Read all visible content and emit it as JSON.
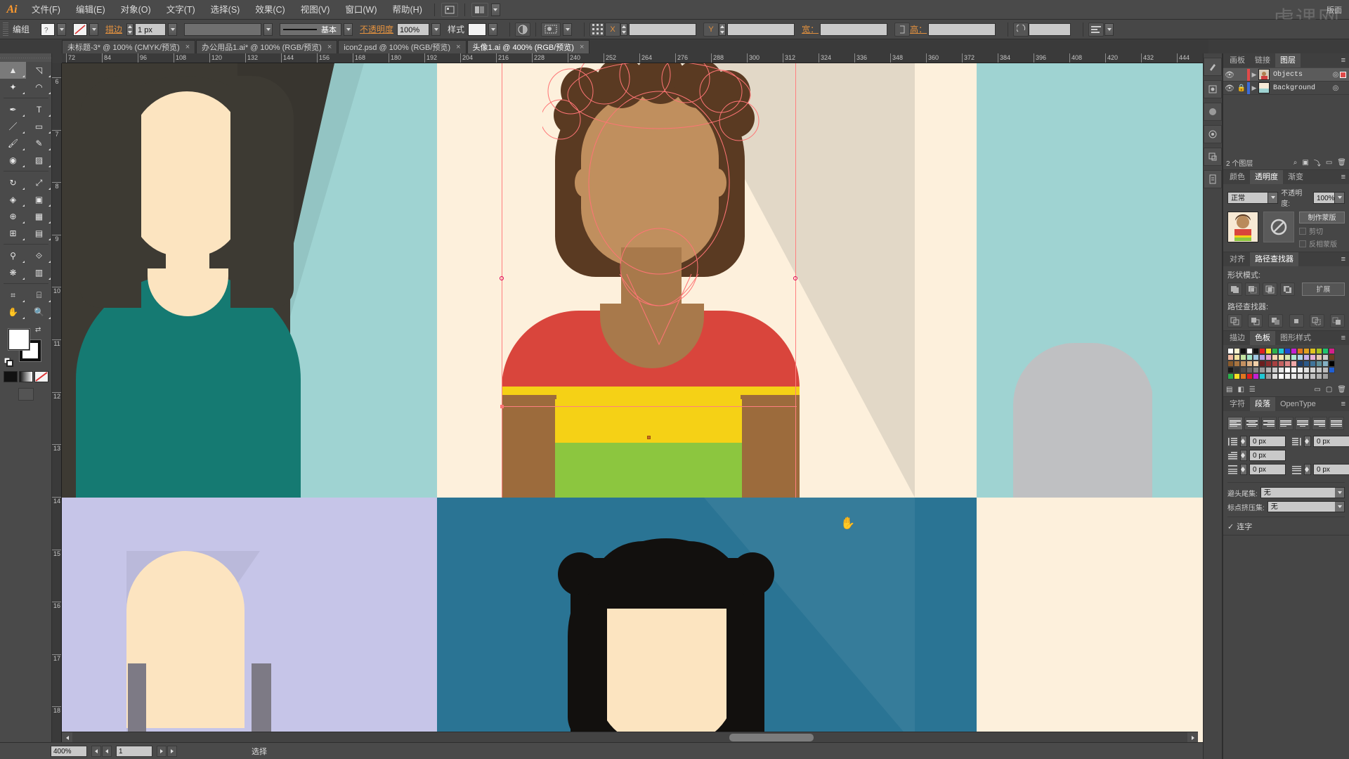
{
  "app": {
    "name": "Ai",
    "workspace_label": "版面"
  },
  "menubar": {
    "items": [
      {
        "label": "文件(F)",
        "name": "menu-file"
      },
      {
        "label": "编辑(E)",
        "name": "menu-edit"
      },
      {
        "label": "对象(O)",
        "name": "menu-object"
      },
      {
        "label": "文字(T)",
        "name": "menu-type"
      },
      {
        "label": "选择(S)",
        "name": "menu-select"
      },
      {
        "label": "效果(C)",
        "name": "menu-effect"
      },
      {
        "label": "视图(V)",
        "name": "menu-view"
      },
      {
        "label": "窗口(W)",
        "name": "menu-window"
      },
      {
        "label": "帮助(H)",
        "name": "menu-help"
      }
    ]
  },
  "controlbar": {
    "selection_label": "编组",
    "fill_swatch": "#f3f3f3",
    "stroke_label": "描边",
    "stroke_weight": "1 px",
    "stroke_profile_placeholder": "",
    "brush_label": "基本",
    "opacity_label": "不透明度",
    "opacity_value": "100%",
    "style_label": "样式",
    "transform_x": "",
    "transform_y": "",
    "width_label": "宽：",
    "width_value": "",
    "height_label": "高：",
    "height_value": "",
    "angle_value": ""
  },
  "tabs": [
    {
      "title": "未标题-3* @ 100% (CMYK/预览)",
      "active": false
    },
    {
      "title": "办公用品1.ai* @ 100% (RGB/预览)",
      "active": false
    },
    {
      "title": "icon2.psd @ 100% (RGB/预览)",
      "active": false
    },
    {
      "title": "头像1.ai @ 400% (RGB/预览)",
      "active": true
    }
  ],
  "rulers": {
    "h_ticks": [
      "72",
      "84",
      "96",
      "108",
      "120",
      "132",
      "144",
      "156",
      "168",
      "180",
      "192",
      "204",
      "216",
      "228",
      "240",
      "252",
      "264",
      "276",
      "288",
      "300",
      "312",
      "324",
      "336",
      "348",
      "360",
      "372",
      "384",
      "396",
      "408",
      "420",
      "432",
      "444"
    ],
    "v_ticks": [
      "6",
      "7",
      "8",
      "9",
      "10",
      "11",
      "12",
      "13",
      "14",
      "15",
      "16",
      "17",
      "18"
    ]
  },
  "toolbox": {
    "tools": [
      {
        "name": "selection-tool",
        "glyph": "▲",
        "selected": true
      },
      {
        "name": "direct-selection-tool",
        "glyph": "◹",
        "selected": false
      },
      {
        "name": "magic-wand-tool",
        "glyph": "✦",
        "selected": false
      },
      {
        "name": "lasso-tool",
        "glyph": "◠",
        "selected": false
      },
      {
        "name": "pen-tool",
        "glyph": "✒",
        "selected": false
      },
      {
        "name": "type-tool",
        "glyph": "T",
        "selected": false
      },
      {
        "name": "line-segment-tool",
        "glyph": "／",
        "selected": false
      },
      {
        "name": "rectangle-tool",
        "glyph": "▭",
        "selected": false
      },
      {
        "name": "paintbrush-tool",
        "glyph": "🖌",
        "selected": false
      },
      {
        "name": "pencil-tool",
        "glyph": "✎",
        "selected": false
      },
      {
        "name": "blob-brush-tool",
        "glyph": "◉",
        "selected": false
      },
      {
        "name": "eraser-tool",
        "glyph": "▨",
        "selected": false
      },
      {
        "name": "rotate-tool",
        "glyph": "↻",
        "selected": false
      },
      {
        "name": "scale-tool",
        "glyph": "⤢",
        "selected": false
      },
      {
        "name": "width-tool",
        "glyph": "◈",
        "selected": false
      },
      {
        "name": "free-transform-tool",
        "glyph": "▣",
        "selected": false
      },
      {
        "name": "shape-builder-tool",
        "glyph": "⊕",
        "selected": false
      },
      {
        "name": "perspective-grid-tool",
        "glyph": "▦",
        "selected": false
      },
      {
        "name": "mesh-tool",
        "glyph": "⊞",
        "selected": false
      },
      {
        "name": "gradient-tool",
        "glyph": "▤",
        "selected": false
      },
      {
        "name": "eyedropper-tool",
        "glyph": "⚲",
        "selected": false
      },
      {
        "name": "blend-tool",
        "glyph": "⟐",
        "selected": false
      },
      {
        "name": "symbol-sprayer-tool",
        "glyph": "❋",
        "selected": false
      },
      {
        "name": "column-graph-tool",
        "glyph": "▥",
        "selected": false
      },
      {
        "name": "artboard-tool",
        "glyph": "⌗",
        "selected": false
      },
      {
        "name": "slice-tool",
        "glyph": "⌸",
        "selected": false
      },
      {
        "name": "hand-tool",
        "glyph": "✋",
        "selected": false
      },
      {
        "name": "zoom-tool",
        "glyph": "🔍",
        "selected": false
      }
    ],
    "fill_color": "#ffffff",
    "stroke_color": "#000000"
  },
  "layers_panel": {
    "tabs": [
      {
        "label": "画板",
        "active": false
      },
      {
        "label": "链接",
        "active": false
      },
      {
        "label": "图层",
        "active": true
      }
    ],
    "rows": [
      {
        "name": "Objects",
        "visible": true,
        "locked": false,
        "selected": true,
        "color": "#e04a4a"
      },
      {
        "name": "Background",
        "visible": true,
        "locked": true,
        "selected": false,
        "color": "#3b6bd6"
      }
    ],
    "footer_count": "2 个图层"
  },
  "transparency_panel": {
    "tabs": [
      {
        "label": "颜色",
        "active": false
      },
      {
        "label": "透明度",
        "active": true
      },
      {
        "label": "渐变",
        "active": false
      }
    ],
    "blend_mode": "正常",
    "opacity_label": "不透明度:",
    "opacity_value": "100%",
    "make_mask_label": "制作蒙版",
    "clip_label": "剪切",
    "invert_label": "反相蒙版"
  },
  "pathfinder_panel": {
    "tabs": [
      {
        "label": "对齐",
        "active": false
      },
      {
        "label": "路径查找器",
        "active": true
      }
    ],
    "shape_modes_label": "形状模式:",
    "expand_label": "扩展",
    "pathfinders_label": "路径查找器:"
  },
  "swatches_panel": {
    "tabs": [
      {
        "label": "描边",
        "active": false
      },
      {
        "label": "色板",
        "active": true
      },
      {
        "label": "图形样式",
        "active": false
      }
    ],
    "colors": [
      "#ffffff",
      "#fdf3d0",
      "#111111",
      "#ffffff",
      "#111111",
      "#e02020",
      "#f5e024",
      "#2bb24c",
      "#1fc8d4",
      "#1f48d4",
      "#c41fd4",
      "#e0761f",
      "#e0a01f",
      "#e0c41f",
      "#a8c41f",
      "#1fc470",
      "#d41f8a",
      "#f2b9a0",
      "#f2e3a0",
      "#c3e3a0",
      "#a0e3c8",
      "#a0c8e3",
      "#b0a0e3",
      "#e3a0d0",
      "#f5d5b0",
      "#f5eab0",
      "#d5e8b0",
      "#b0e8d5",
      "#b0d5e8",
      "#c8b0e8",
      "#e8b0d5",
      "#e8c8b0",
      "#cccccc",
      "#6b3f1f",
      "#8a5a2b",
      "#a87440",
      "#c49060",
      "#ddb184",
      "#f0cfa8",
      "#6b1f1f",
      "#8a2b2b",
      "#a84040",
      "#c46060",
      "#dd8484",
      "#f0a8a8",
      "#1f3f6b",
      "#2b5a8a",
      "#40749a",
      "#60909a",
      "#84b1c4",
      "#000000",
      "#1a1a1a",
      "#333333",
      "#4d4d4d",
      "#666666",
      "#808080",
      "#999999",
      "#b3b3b3",
      "#cccccc",
      "#e6e6e6",
      "#ffffff",
      "#f5f5f5",
      "#ededed",
      "#e0e0e0",
      "#d4d4d4",
      "#c8c8c8",
      "#bcbcbc",
      "#1f5fd4",
      "#2bb24c",
      "#f5e024",
      "#e0761f",
      "#e02020",
      "#c41fd4",
      "#1fc8d4",
      "#999999",
      "#dddddd",
      "#ffffff",
      "#f0f0f0",
      "#e8e8e8",
      "#dedede",
      "#d0d0d0",
      "#c0c0c0",
      "#b0b0b0",
      "#a0a0a0"
    ]
  },
  "paragraph_panel": {
    "tabs": [
      {
        "label": "字符",
        "active": false
      },
      {
        "label": "段落",
        "active": true
      },
      {
        "label": "OpenType",
        "active": false
      }
    ],
    "indent_left": "0 px",
    "indent_right": "0 px",
    "indent_first": "0 px",
    "space_before": "0 px",
    "space_after": "0 px",
    "hyphen_label": "避头尾集:",
    "hyphen_value": "无",
    "burasagari_label": "标点挤压集:",
    "burasagari_value": "无",
    "ligature_label": "连字",
    "ligature_checked": true
  },
  "statusbar": {
    "zoom": "400%",
    "page": "1",
    "status_text": "选择"
  },
  "canvas": {
    "zoom_level": "400%",
    "colors": {
      "teal_bg": "#9fd3d2",
      "dark_hair": "#3d3a33",
      "skin_light": "#fce4c0",
      "teal_shirt": "#157a72",
      "cream_bg": "#fdf0dc",
      "brown_hair": "#5a3a22",
      "skin_med": "#c08f5e",
      "skin_shade": "#a8794b",
      "red_shirt": "#d9453c",
      "yellow": "#f5d116",
      "green": "#8cc63f",
      "box_brown": "#9c6b3c",
      "shadow_cream": "#ded3c2",
      "lavender": "#c6c5e8",
      "blue_bg": "#2a7494",
      "black_hair": "#12100e",
      "gray_bg": "#bfc0c2"
    }
  }
}
